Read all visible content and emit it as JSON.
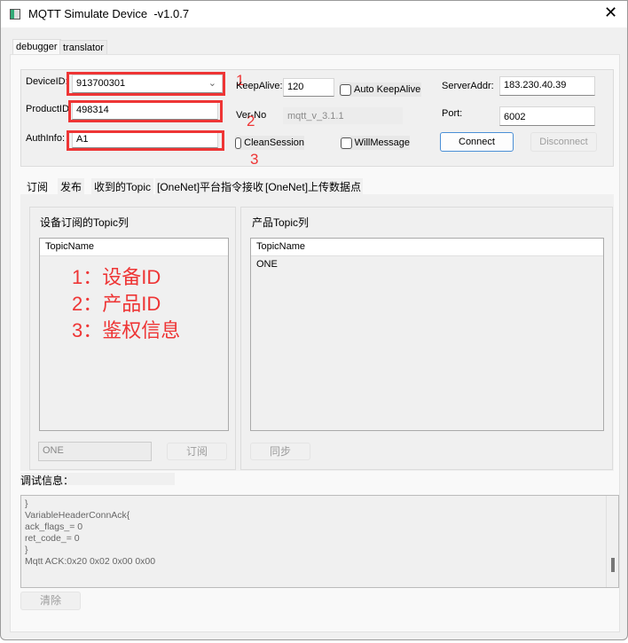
{
  "window": {
    "title": "MQTT Simulate Device  -v1.0.7",
    "close_icon": "close-icon"
  },
  "main_tabs": [
    {
      "label": "debugger",
      "active": true
    },
    {
      "label": "translator",
      "active": false
    }
  ],
  "connection": {
    "device_id_label": "DeviceID:",
    "device_id_value": "913700301",
    "product_id_label": "ProductID:",
    "product_id_value": "498314",
    "auth_info_label": "AuthInfo:",
    "auth_info_value": "A1",
    "keepalive_label": "KeepAlive:",
    "keepalive_value": "120",
    "auto_keepalive_label": "Auto KeepAlive",
    "verno_label": "Ver-No",
    "verno_value": "mqtt_v_3.1.1",
    "clean_session_label": "CleanSession",
    "will_message_label": "WillMessage",
    "server_addr_label": "ServerAddr:",
    "server_addr_value": "183.230.40.39",
    "port_label": "Port:",
    "port_value": "6002",
    "connect_label": "Connect",
    "disconnect_label": "Disconnect"
  },
  "annotations": {
    "n1": "1",
    "n2": "2",
    "n3": "3",
    "lines": [
      "1：设备ID",
      "2：产品ID",
      "3：鉴权信息"
    ],
    "color": "#ee3535"
  },
  "sub_tabs": [
    "订阅",
    "发布",
    "收到的Topic",
    "[OneNet]平台指令接收",
    "[OneNet]上传数据点"
  ],
  "subscribe": {
    "left_title": "设备订阅的Topic列",
    "left_header": "TopicName",
    "topic_input": "ONE",
    "subscribe_label": "订阅",
    "right_title": "产品Topic列",
    "right_header": "TopicName",
    "right_items": [
      "ONE"
    ],
    "sync_label": "同步"
  },
  "debug": {
    "label": "调试信息：",
    "log": "}\nVariableHeaderConnAck{\nack_flags_= 0\nret_code_= 0\n}\nMqtt ACK:0x20 0x02 0x00 0x00",
    "clear_label": "清除"
  }
}
